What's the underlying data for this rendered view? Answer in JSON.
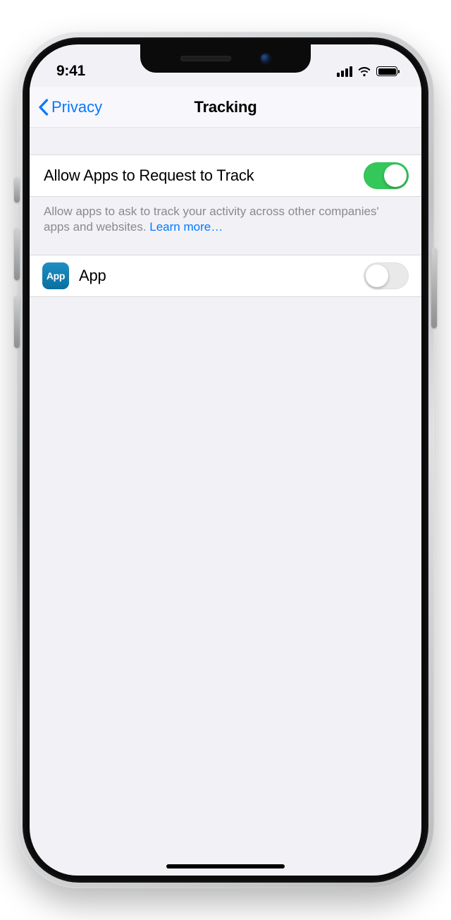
{
  "statusbar": {
    "time": "9:41"
  },
  "nav": {
    "back_label": "Privacy",
    "title": "Tracking"
  },
  "track": {
    "allow_label": "Allow Apps to Request to Track",
    "allow_on": true,
    "footer_text": "Allow apps to ask to track your activity across other companies' apps and websites. ",
    "learn_more": "Learn more…"
  },
  "apps": [
    {
      "icon_text": "App",
      "name": "App",
      "enabled": false
    }
  ]
}
